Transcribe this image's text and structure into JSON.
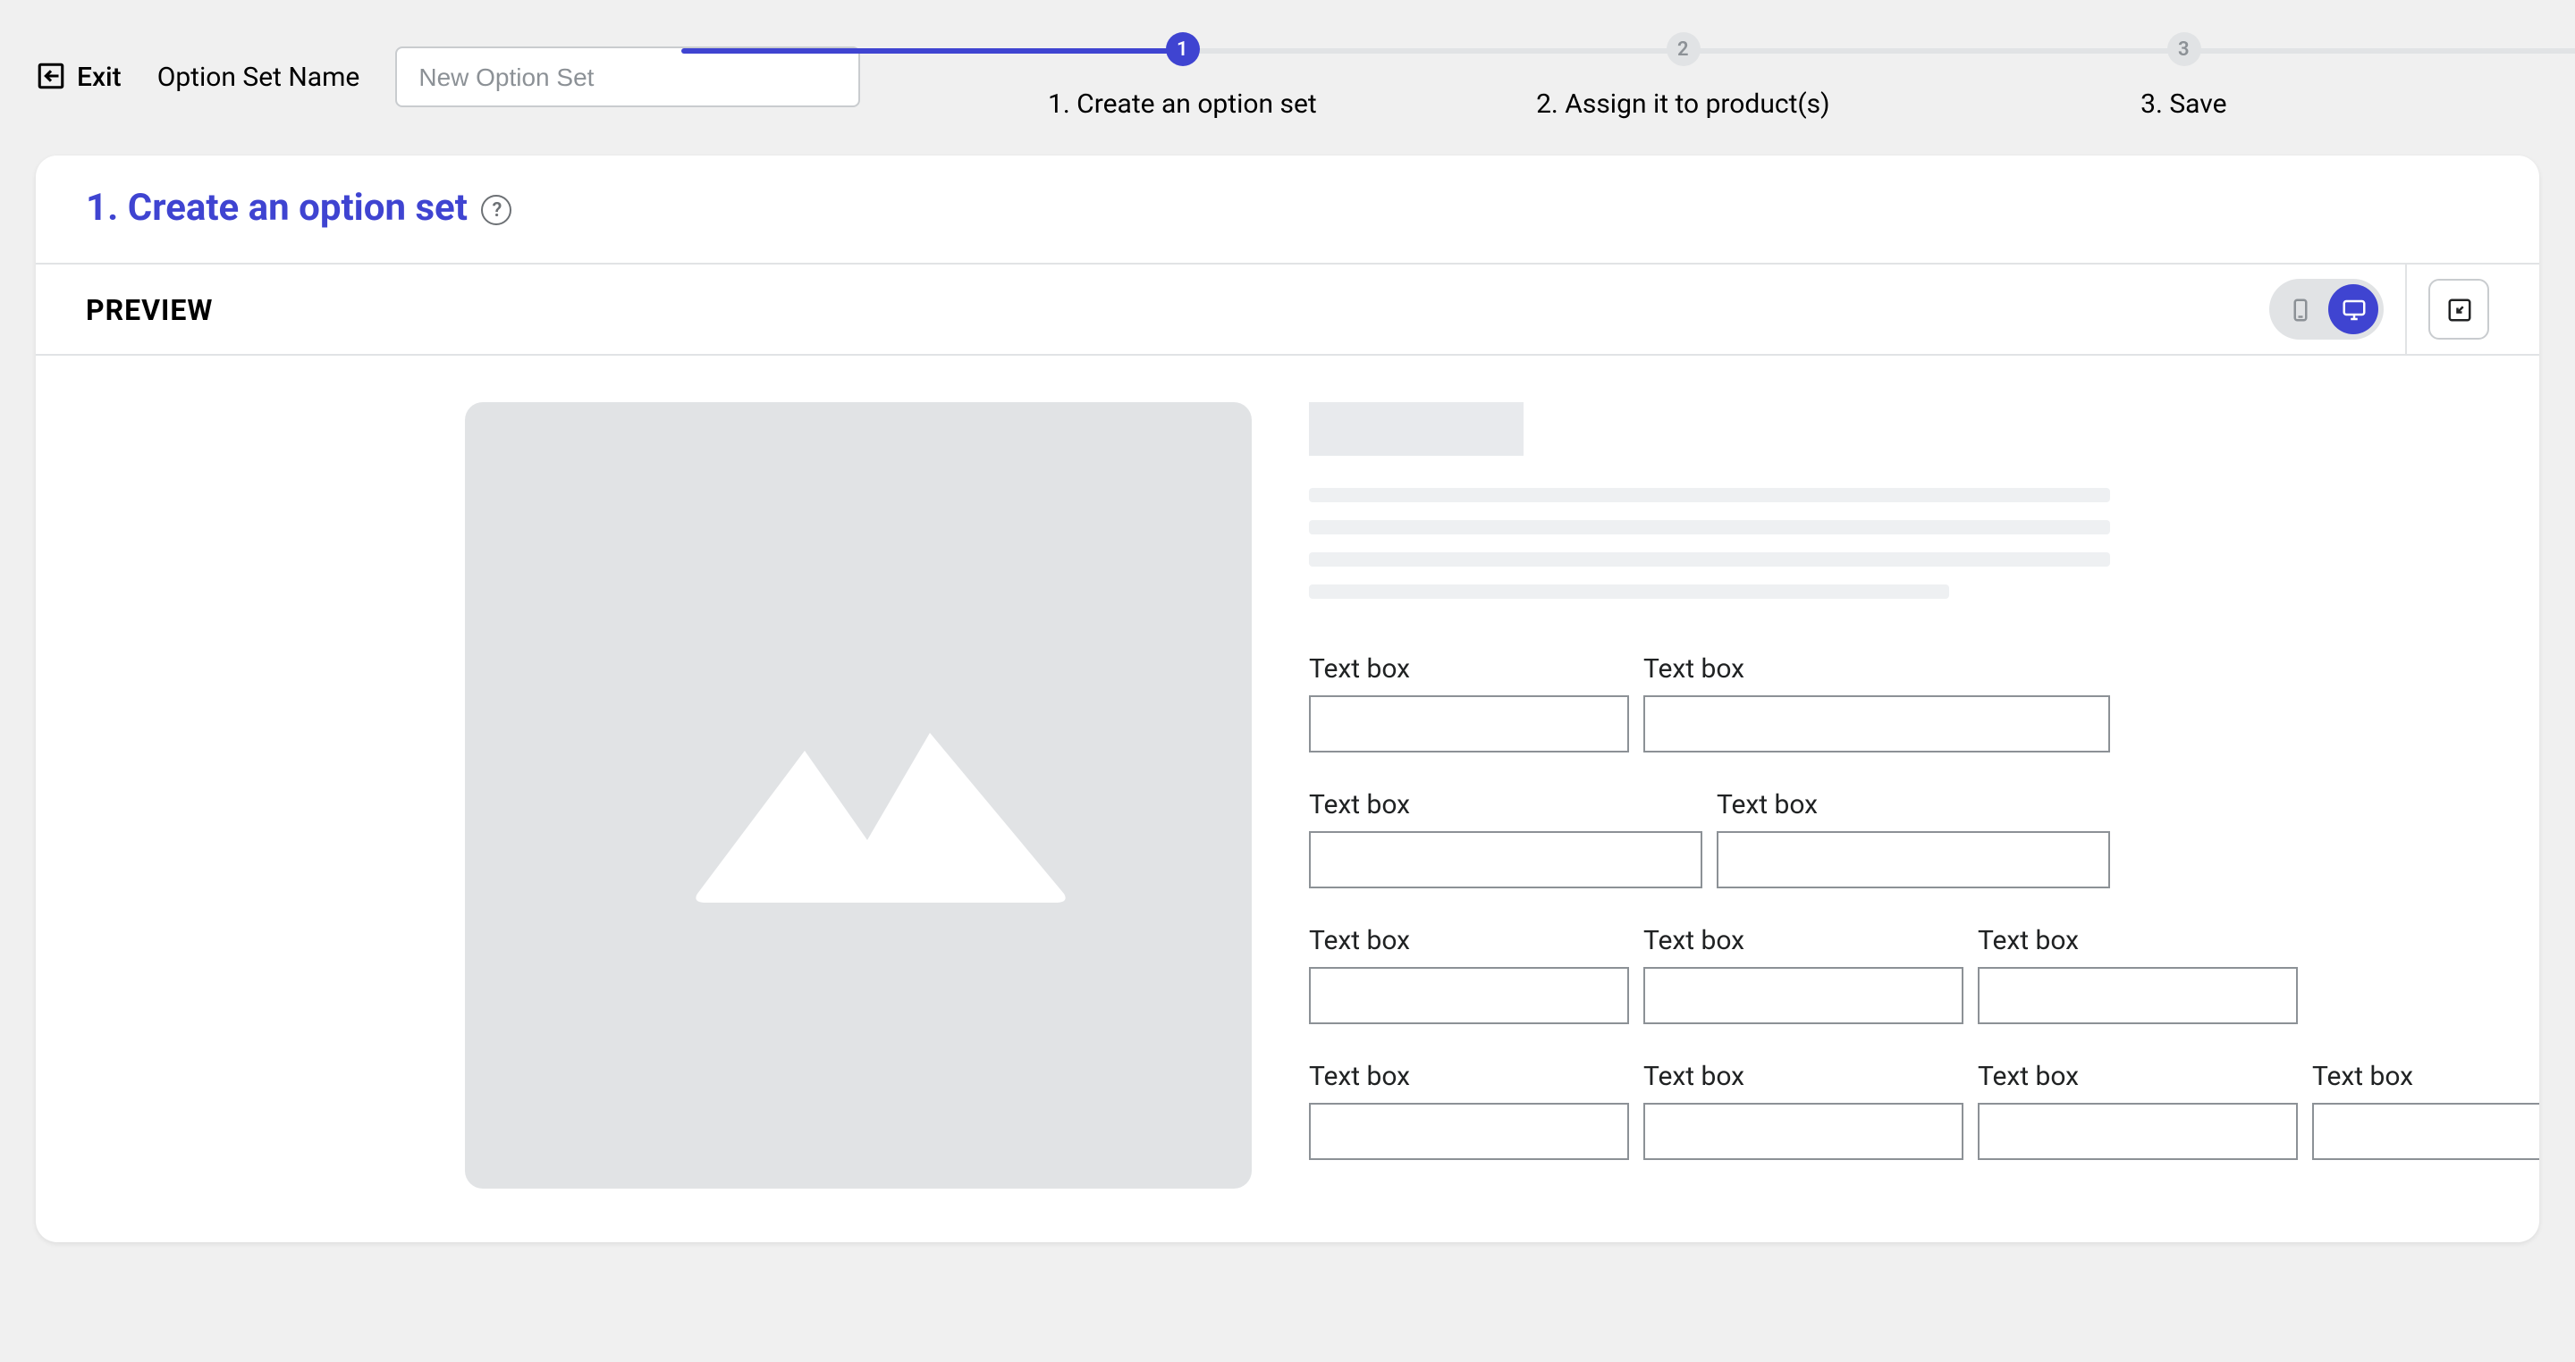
{
  "topBar": {
    "exitLabel": "Exit",
    "optionNameLabel": "Option Set Name",
    "optionNamePlaceholder": "New Option Set"
  },
  "stepper": {
    "steps": [
      {
        "num": "1",
        "label": "1. Create an option set"
      },
      {
        "num": "2",
        "label": "2. Assign it to product(s)"
      },
      {
        "num": "3",
        "label": "3. Save"
      }
    ]
  },
  "card": {
    "title": "1. Create an option set",
    "helpGlyph": "?"
  },
  "preview": {
    "label": "PREVIEW"
  },
  "form": {
    "rows": [
      {
        "fields": [
          "Text box",
          "Text box"
        ]
      },
      {
        "fields": [
          "Text box",
          "Text box"
        ]
      },
      {
        "fields": [
          "Text box",
          "Text box",
          "Text box"
        ]
      },
      {
        "fields": [
          "Text box",
          "Text box",
          "Text box",
          "Text box"
        ]
      }
    ]
  }
}
